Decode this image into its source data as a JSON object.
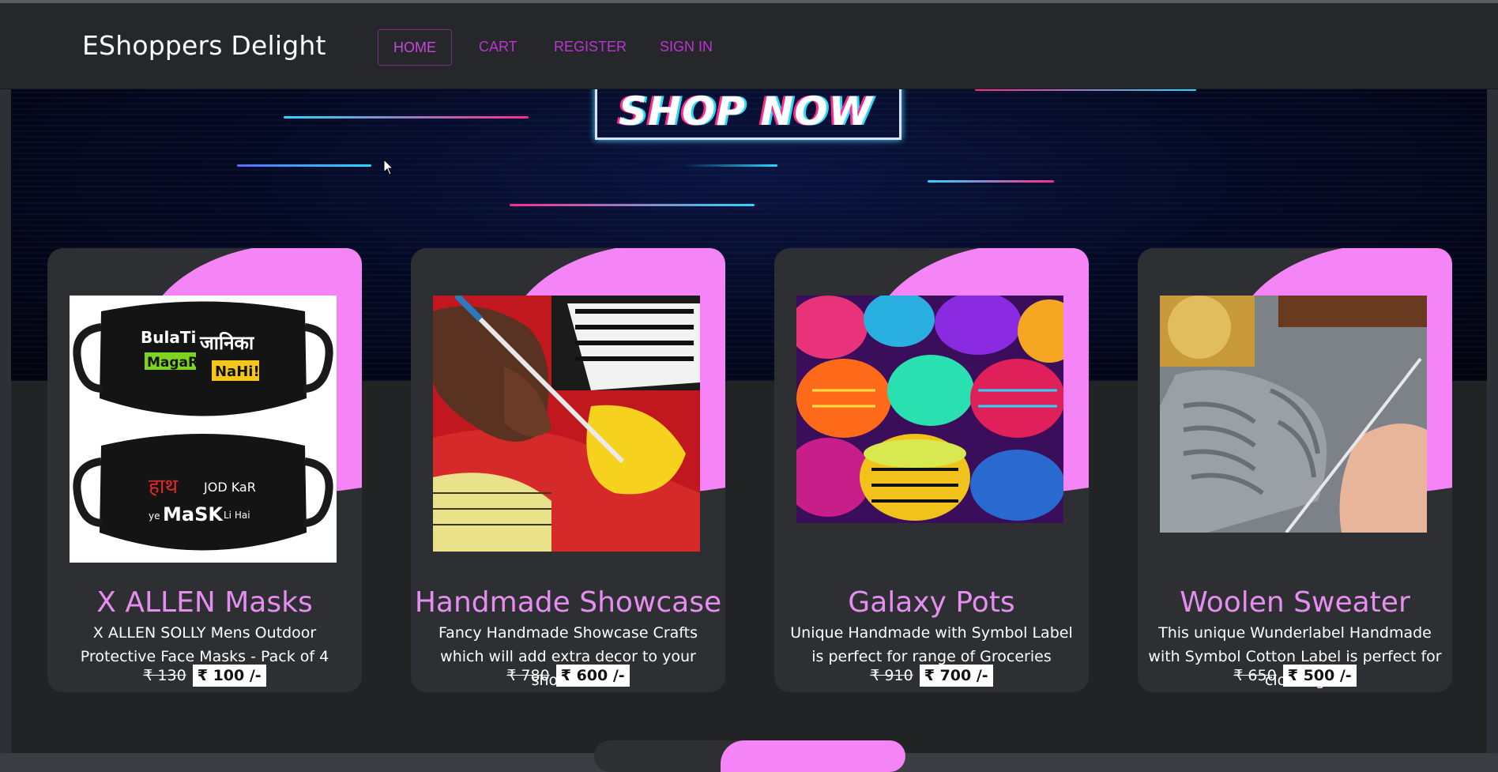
{
  "app": {
    "brand": "EShoppers Delight"
  },
  "nav": {
    "items": [
      {
        "label": "HOME",
        "active": true
      },
      {
        "label": "CART",
        "active": false
      },
      {
        "label": "REGISTER",
        "active": false
      },
      {
        "label": "SIGN IN",
        "active": false
      }
    ]
  },
  "hero": {
    "banner_text": "SHOP NOW"
  },
  "products": [
    {
      "title": "X ALLEN Masks",
      "description": "X ALLEN SOLLY Mens Outdoor Protective Face Masks - Pack of 4",
      "old_price": "₹ 130",
      "new_price": "₹ 100 /-",
      "image_text": {
        "line1a": "BulaTi",
        "line1b": "जानिका",
        "line2a": "MagaR",
        "line2b": "NaHi!",
        "line3a": "हाथ",
        "line3b": "JOD KaR",
        "line4a": "ye",
        "line4b": "MaSK",
        "line4c": "Li Hai"
      }
    },
    {
      "title": "Handmade Showcase",
      "description": "Fancy Handmade Showcase Crafts which will add extra decor to your showcase",
      "old_price": "₹ 780",
      "new_price": "₹ 600 /-"
    },
    {
      "title": "Galaxy Pots",
      "description": "Unique Handmade with Symbol Label is perfect for range of Groceries",
      "old_price": "₹ 910",
      "new_price": "₹ 700 /-"
    },
    {
      "title": "Woolen Sweater",
      "description": "This unique Wunderlabel Handmade with Symbol Cotton Label is perfect for clothing",
      "old_price": "₹ 650",
      "new_price": "₹ 500 /-"
    }
  ],
  "colors": {
    "accent_pink": "#f585f7",
    "nav_link": "#bb35d0",
    "title_pink": "#e58ef0",
    "card_bg": "#2e2f32"
  }
}
